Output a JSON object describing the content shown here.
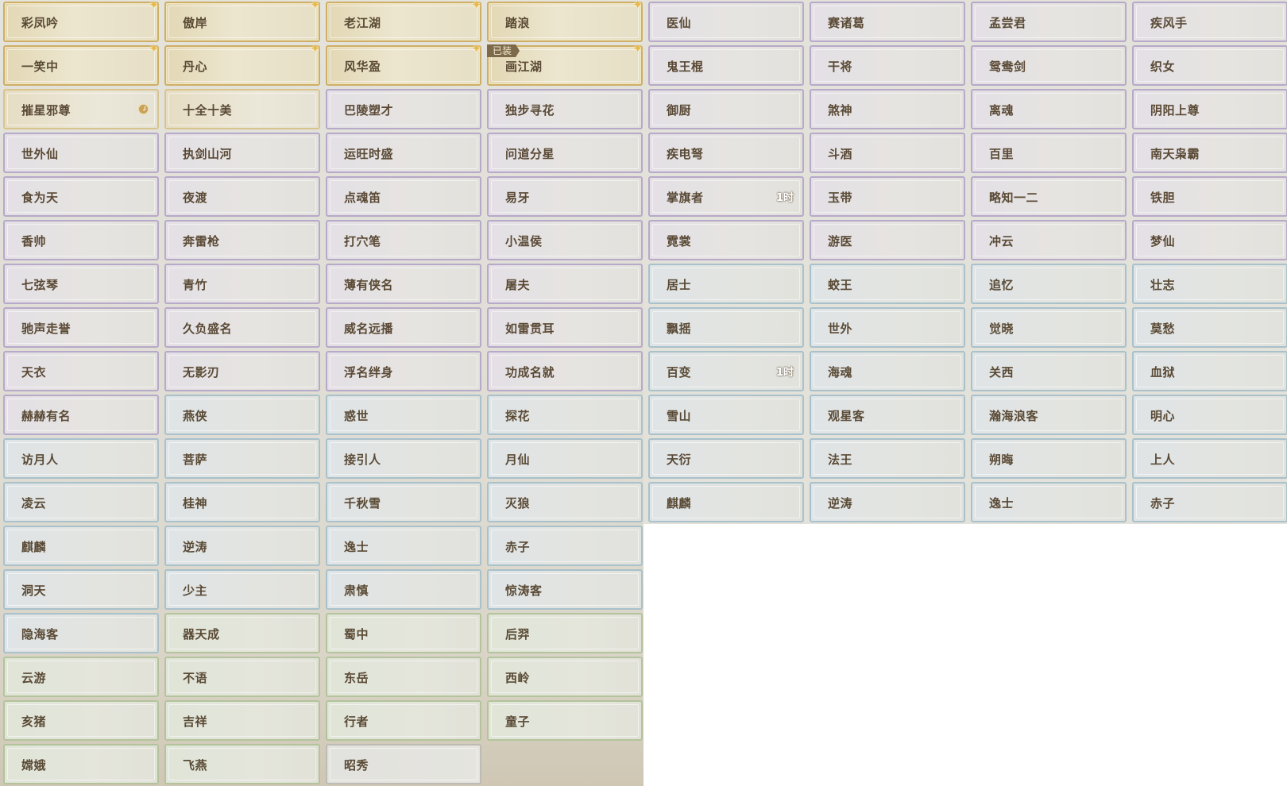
{
  "colors": {
    "text": "#5a4a35",
    "gold_border": "#cdae66",
    "purple_border": "#b7a9c9",
    "blue_border": "#a9c1cb",
    "green_border": "#b3c49c",
    "badge_bg": "#7d6a4a"
  },
  "right_grid": [
    [
      {
        "label": "医仙",
        "tier": "purple"
      },
      {
        "label": "赛诸葛",
        "tier": "purple"
      },
      {
        "label": "孟尝君",
        "tier": "purple"
      },
      {
        "label": "疾风手",
        "tier": "purple"
      }
    ],
    [
      {
        "label": "鬼王棍",
        "tier": "purple"
      },
      {
        "label": "干将",
        "tier": "purple"
      },
      {
        "label": "鸳鸯剑",
        "tier": "purple"
      },
      {
        "label": "织女",
        "tier": "purple"
      }
    ],
    [
      {
        "label": "御厨",
        "tier": "purple"
      },
      {
        "label": "煞神",
        "tier": "purple"
      },
      {
        "label": "离魂",
        "tier": "purple"
      },
      {
        "label": "阴阳上尊",
        "tier": "purple"
      }
    ],
    [
      {
        "label": "疾电弩",
        "tier": "purple"
      },
      {
        "label": "斗酒",
        "tier": "purple"
      },
      {
        "label": "百里",
        "tier": "purple"
      },
      {
        "label": "南天枭霸",
        "tier": "purple"
      }
    ],
    [
      {
        "label": "掌旗者",
        "tier": "purple",
        "timer": "1时"
      },
      {
        "label": "玉带",
        "tier": "purple"
      },
      {
        "label": "略知一二",
        "tier": "purple"
      },
      {
        "label": "铁胆",
        "tier": "purple"
      }
    ],
    [
      {
        "label": "霓裳",
        "tier": "purple"
      },
      {
        "label": "游医",
        "tier": "purple"
      },
      {
        "label": "冲云",
        "tier": "purple"
      },
      {
        "label": "梦仙",
        "tier": "purple"
      }
    ],
    [
      {
        "label": "居士",
        "tier": "blue"
      },
      {
        "label": "蛟王",
        "tier": "blue"
      },
      {
        "label": "追忆",
        "tier": "blue"
      },
      {
        "label": "壮志",
        "tier": "blue"
      }
    ],
    [
      {
        "label": "飘摇",
        "tier": "blue"
      },
      {
        "label": "世外",
        "tier": "blue"
      },
      {
        "label": "觉晓",
        "tier": "blue"
      },
      {
        "label": "莫愁",
        "tier": "blue"
      }
    ],
    [
      {
        "label": "百变",
        "tier": "blue",
        "timer": "1时"
      },
      {
        "label": "海魂",
        "tier": "blue"
      },
      {
        "label": "关西",
        "tier": "blue"
      },
      {
        "label": "血狱",
        "tier": "blue"
      }
    ],
    [
      {
        "label": "雪山",
        "tier": "blue"
      },
      {
        "label": "观星客",
        "tier": "blue"
      },
      {
        "label": "瀚海浪客",
        "tier": "blue"
      },
      {
        "label": "明心",
        "tier": "blue"
      }
    ],
    [
      {
        "label": "天衍",
        "tier": "blue"
      },
      {
        "label": "法王",
        "tier": "blue"
      },
      {
        "label": "朔晦",
        "tier": "blue"
      },
      {
        "label": "上人",
        "tier": "blue"
      }
    ],
    [
      {
        "label": "麒麟",
        "tier": "blue"
      },
      {
        "label": "逆涛",
        "tier": "blue"
      },
      {
        "label": "逸士",
        "tier": "blue"
      },
      {
        "label": "赤子",
        "tier": "blue"
      }
    ]
  ],
  "left_grid": [
    [
      {
        "label": "彩凤吟",
        "tier": "gold",
        "sparkle": true
      },
      {
        "label": "傲岸",
        "tier": "gold",
        "sparkle": true
      },
      {
        "label": "老江湖",
        "tier": "gold",
        "sparkle": true
      },
      {
        "label": "踏浪",
        "tier": "gold",
        "sparkle": true
      }
    ],
    [
      {
        "label": "一笑中",
        "tier": "gold",
        "sparkle": true
      },
      {
        "label": "丹心",
        "tier": "gold",
        "sparkle": true
      },
      {
        "label": "风华盈",
        "tier": "gold",
        "sparkle": true
      },
      {
        "label": "画江湖",
        "tier": "gold",
        "sparkle": true,
        "badge": "已装"
      }
    ],
    [
      {
        "label": "摧星邪尊",
        "tier": "goldlite",
        "clock": true
      },
      {
        "label": "十全十美",
        "tier": "goldlite"
      },
      {
        "label": "巴陵塑才",
        "tier": "purple"
      },
      {
        "label": "独步寻花",
        "tier": "purple"
      }
    ],
    [
      {
        "label": "世外仙",
        "tier": "purple"
      },
      {
        "label": "执剑山河",
        "tier": "purple"
      },
      {
        "label": "运旺时盛",
        "tier": "purple"
      },
      {
        "label": "问道分星",
        "tier": "purple"
      }
    ],
    [
      {
        "label": "食为天",
        "tier": "purple"
      },
      {
        "label": "夜渡",
        "tier": "purple"
      },
      {
        "label": "点魂笛",
        "tier": "purple"
      },
      {
        "label": "易牙",
        "tier": "purple"
      }
    ],
    [
      {
        "label": "香帅",
        "tier": "purple"
      },
      {
        "label": "奔雷枪",
        "tier": "purple"
      },
      {
        "label": "打穴笔",
        "tier": "purple"
      },
      {
        "label": "小温侯",
        "tier": "purple"
      }
    ],
    [
      {
        "label": "七弦琴",
        "tier": "purple"
      },
      {
        "label": "青竹",
        "tier": "purple"
      },
      {
        "label": "薄有侠名",
        "tier": "purple"
      },
      {
        "label": "屠夫",
        "tier": "purple"
      }
    ],
    [
      {
        "label": "驰声走誉",
        "tier": "purple"
      },
      {
        "label": "久负盛名",
        "tier": "purple"
      },
      {
        "label": "威名远播",
        "tier": "purple"
      },
      {
        "label": "如雷贯耳",
        "tier": "purple"
      }
    ],
    [
      {
        "label": "天衣",
        "tier": "purple"
      },
      {
        "label": "无影刃",
        "tier": "purple"
      },
      {
        "label": "浮名绊身",
        "tier": "purple"
      },
      {
        "label": "功成名就",
        "tier": "purple"
      }
    ],
    [
      {
        "label": "赫赫有名",
        "tier": "purple"
      },
      {
        "label": "燕侠",
        "tier": "blue"
      },
      {
        "label": "惑世",
        "tier": "blue"
      },
      {
        "label": "探花",
        "tier": "blue"
      }
    ],
    [
      {
        "label": "访月人",
        "tier": "blue"
      },
      {
        "label": "菩萨",
        "tier": "blue"
      },
      {
        "label": "接引人",
        "tier": "blue"
      },
      {
        "label": "月仙",
        "tier": "blue"
      }
    ],
    [
      {
        "label": "凌云",
        "tier": "blue"
      },
      {
        "label": "桂神",
        "tier": "blue"
      },
      {
        "label": "千秋雪",
        "tier": "blue"
      },
      {
        "label": "灭狼",
        "tier": "blue"
      }
    ],
    [
      {
        "label": "麒麟",
        "tier": "blue"
      },
      {
        "label": "逆涛",
        "tier": "blue"
      },
      {
        "label": "逸士",
        "tier": "blue"
      },
      {
        "label": "赤子",
        "tier": "blue"
      }
    ],
    [
      {
        "label": "洞天",
        "tier": "blue"
      },
      {
        "label": "少主",
        "tier": "blue"
      },
      {
        "label": "肃慎",
        "tier": "blue"
      },
      {
        "label": "惊涛客",
        "tier": "blue"
      }
    ],
    [
      {
        "label": "隐海客",
        "tier": "blue"
      },
      {
        "label": "器天成",
        "tier": "green"
      },
      {
        "label": "蜀中",
        "tier": "green"
      },
      {
        "label": "后羿",
        "tier": "green"
      }
    ],
    [
      {
        "label": "云游",
        "tier": "green"
      },
      {
        "label": "不语",
        "tier": "green"
      },
      {
        "label": "东岳",
        "tier": "green"
      },
      {
        "label": "西岭",
        "tier": "green"
      }
    ],
    [
      {
        "label": "亥猪",
        "tier": "green"
      },
      {
        "label": "吉祥",
        "tier": "green"
      },
      {
        "label": "行者",
        "tier": "green"
      },
      {
        "label": "童子",
        "tier": "green"
      }
    ],
    [
      {
        "label": "嫦娥",
        "tier": "green"
      },
      {
        "label": "飞燕",
        "tier": "green"
      },
      {
        "label": "昭秀",
        "tier": "grey"
      }
    ]
  ]
}
